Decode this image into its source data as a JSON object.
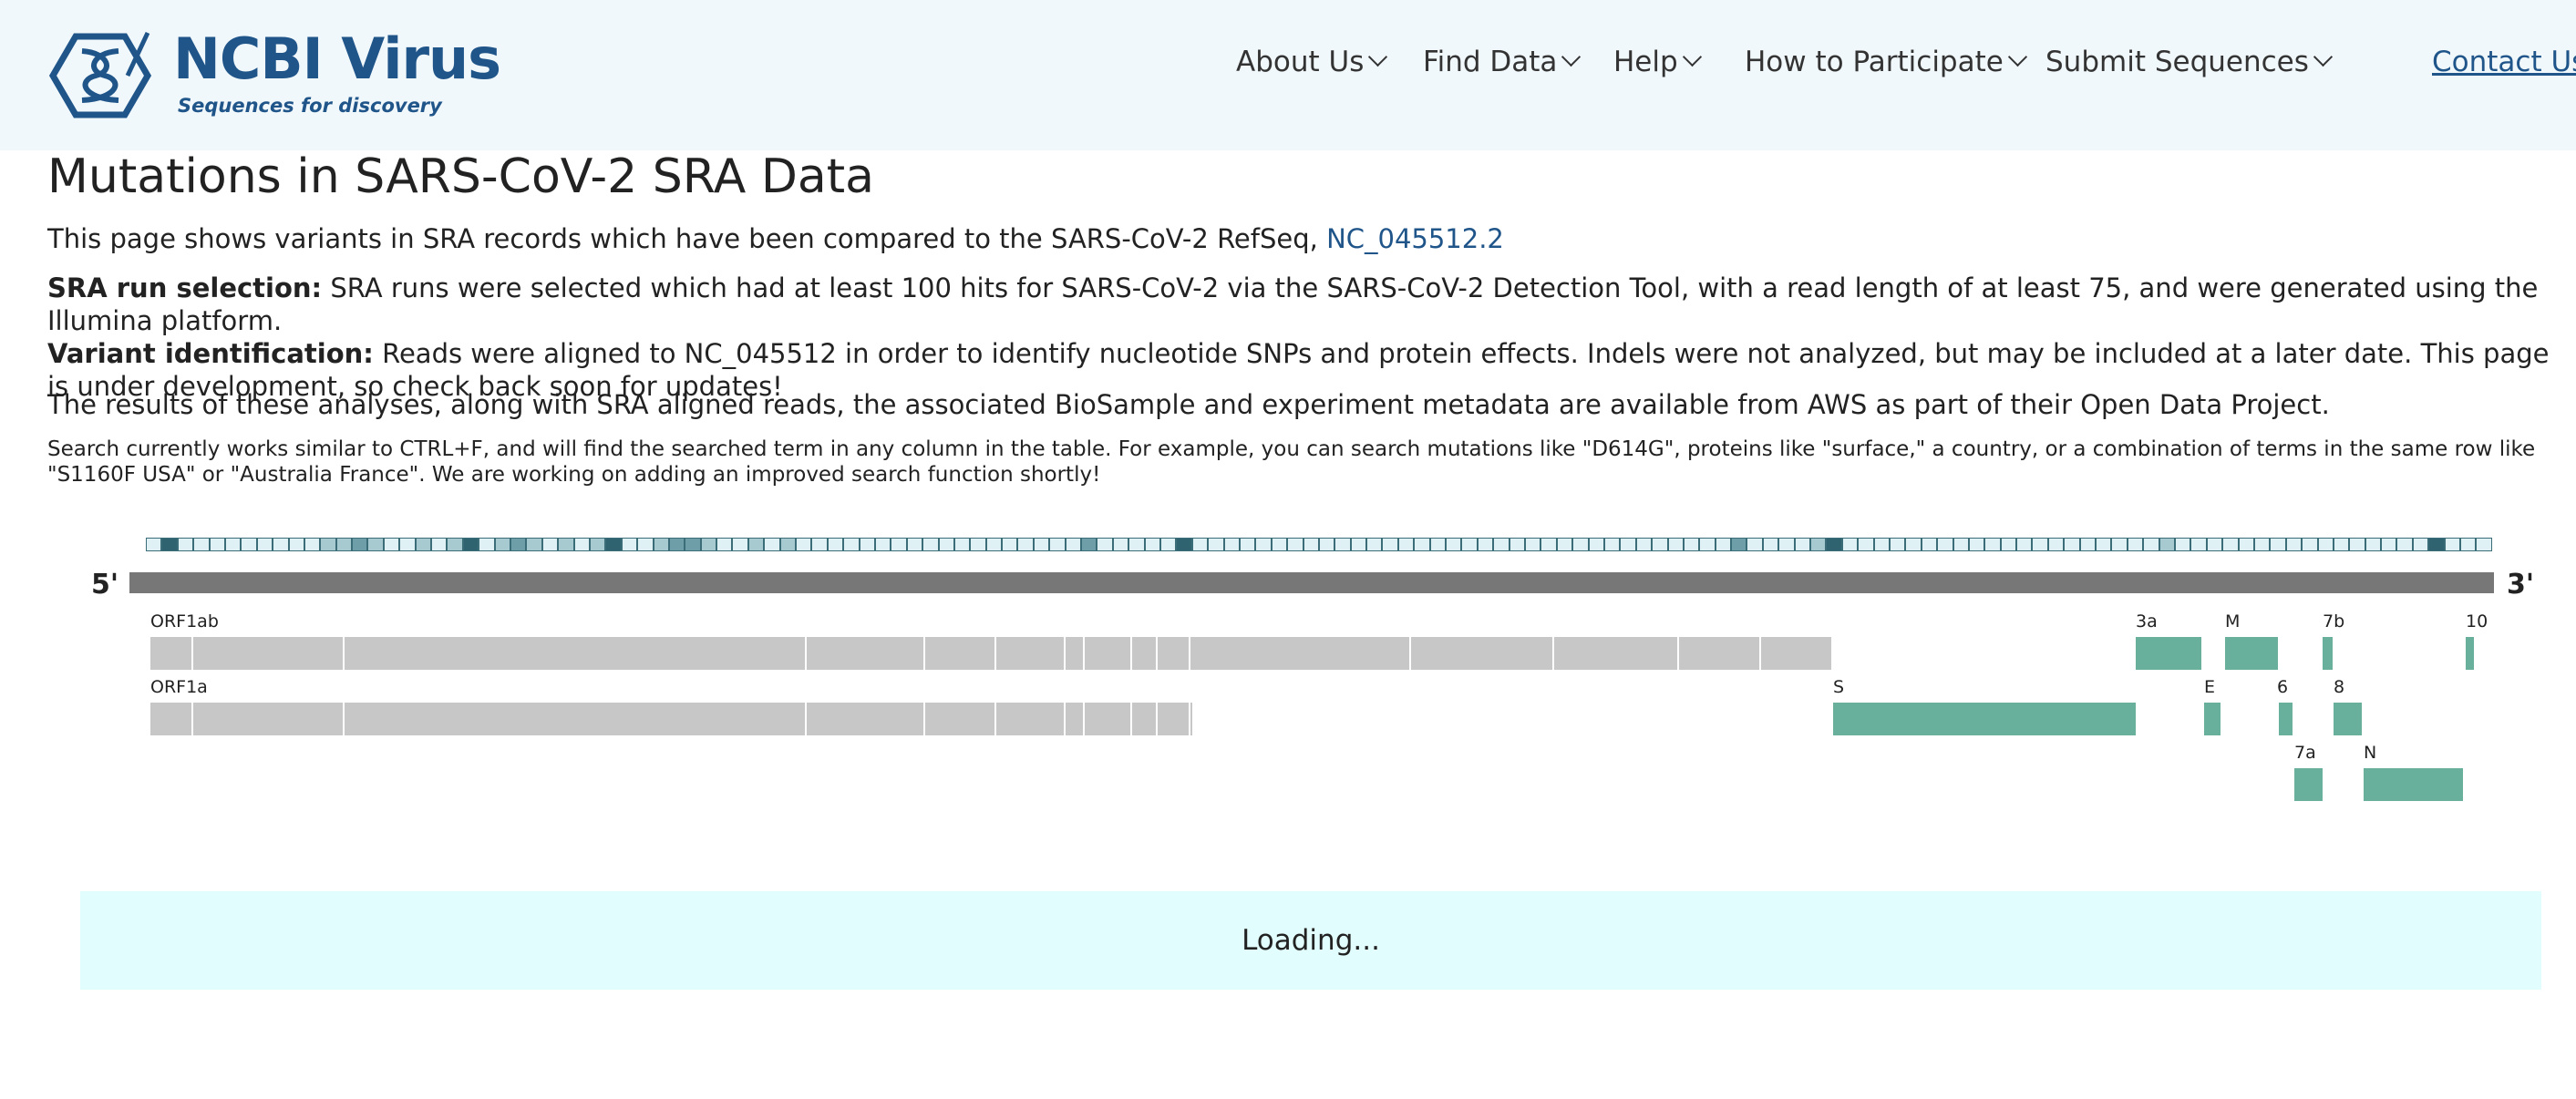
{
  "header": {
    "logo_title": "NCBI Virus",
    "logo_tagline": "Sequences for discovery",
    "nav": [
      "About Us",
      "Find Data",
      "Help",
      "How to Participate",
      "Submit Sequences"
    ],
    "contact": "Contact Us"
  },
  "page": {
    "title": "Mutations in SARS-CoV-2 SRA Data",
    "intro": "This page shows variants in SRA records which have been compared to the SARS-CoV-2 RefSeq, ",
    "refseq_link": "NC_045512.2",
    "sra_label": "SRA run selection:",
    "sra_text": " SRA runs were selected which had at least 100 hits for SARS-CoV-2 via the SARS-CoV-2 Detection Tool, with a read length of at least 75, and were generated using the Illumina platform.",
    "variant_label": "Variant identification:",
    "variant_text": " Reads were aligned to NC_045512 in order to identify nucleotide SNPs and protein effects. Indels were not analyzed, but may be included at a later date. This page is under development, so check back soon for updates!",
    "results_text": "The results of these analyses, along with SRA aligned reads, the associated BioSample and experiment metadata are available from AWS as part of their Open Data Project.",
    "search_note": "Search currently works similar to CTRL+F, and will find the searched term in any column in the table. For example, you can search mutations like \"D614G\", proteins like \"surface,\" a country, or a combination of terms in the same row like \"S1160F USA\" or \"Australia France\". We are working on adding an improved search function shortly!",
    "loading": "Loading..."
  },
  "genome_map": {
    "five_prime": "5'",
    "three_prime": "3'",
    "gene_labels": [
      "ORF1ab",
      "ORF1a",
      "S",
      "3a",
      "M",
      "7b",
      "10",
      "E",
      "6",
      "8",
      "7a",
      "N"
    ],
    "colors": {
      "orf_segment": "#c7c7c7",
      "gene": "#69b09c",
      "genome_bar": "#777777",
      "mut_light": "#dff1f5",
      "mut_mid": "#a7c9d0",
      "mut_mid2": "#6e9ea8",
      "mut_dark": "#2f6370"
    },
    "mutation_intensity": [
      0,
      3,
      0,
      0,
      0,
      0,
      0,
      0,
      0,
      0,
      0,
      1,
      1,
      2,
      1,
      0,
      0,
      1,
      0,
      1,
      3,
      0,
      1,
      2,
      1,
      0,
      1,
      0,
      1,
      3,
      0,
      0,
      1,
      2,
      2,
      1,
      0,
      0,
      1,
      0,
      1,
      0,
      0,
      0,
      0,
      0,
      0,
      0,
      0,
      0,
      0,
      0,
      0,
      0,
      0,
      0,
      0,
      0,
      0,
      2,
      0,
      0,
      0,
      0,
      0,
      3,
      0,
      0,
      0,
      0,
      0,
      0,
      0,
      0,
      0,
      0,
      0,
      0,
      0,
      0,
      0,
      0,
      0,
      0,
      0,
      0,
      0,
      0,
      0,
      0,
      0,
      0,
      0,
      0,
      0,
      0,
      0,
      0,
      0,
      0,
      2,
      0,
      0,
      0,
      0,
      1,
      3,
      0,
      0,
      0,
      0,
      0,
      0,
      0,
      0,
      0,
      0,
      0,
      0,
      0,
      0,
      0,
      0,
      0,
      0,
      0,
      0,
      1,
      0,
      0,
      0,
      0,
      0,
      0,
      0,
      0,
      0,
      0,
      0,
      0,
      0,
      0,
      0,
      0,
      3,
      0,
      0,
      0
    ]
  }
}
